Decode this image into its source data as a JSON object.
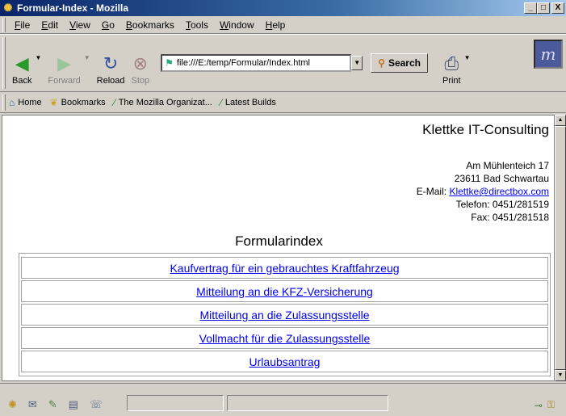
{
  "window": {
    "title": "Formular-Index - Mozilla",
    "min": "_",
    "max": "□",
    "close": "X"
  },
  "menu": [
    {
      "label": "File",
      "ul": "F",
      "rest": "ile"
    },
    {
      "label": "Edit",
      "ul": "E",
      "rest": "dit"
    },
    {
      "label": "View",
      "ul": "V",
      "rest": "iew"
    },
    {
      "label": "Go",
      "ul": "G",
      "rest": "o"
    },
    {
      "label": "Bookmarks",
      "ul": "B",
      "rest": "ookmarks"
    },
    {
      "label": "Tools",
      "ul": "T",
      "rest": "ools"
    },
    {
      "label": "Window",
      "ul": "W",
      "rest": "indow"
    },
    {
      "label": "Help",
      "ul": "H",
      "rest": "elp"
    }
  ],
  "nav": {
    "back": "Back",
    "forward": "Forward",
    "reload": "Reload",
    "stop": "Stop",
    "url": "file:///E:/temp/Formular/Index.html",
    "search": "Search",
    "print": "Print"
  },
  "personal": {
    "home": "Home",
    "bookmarks": "Bookmarks",
    "mozilla_org": "The Mozilla Organizat...",
    "latest_builds": "Latest Builds"
  },
  "page": {
    "company": "Klettke IT-Consulting",
    "street": "Am Mühlenteich 17",
    "city": "23611 Bad Schwartau",
    "email_label": "E-Mail: ",
    "email": "Klettke@directbox.com",
    "phone": "Telefon: 0451/281519",
    "fax": "Fax: 0451/281518",
    "heading": "Formularindex",
    "forms": [
      "Kaufvertrag für ein gebrauchtes Kraftfahrzeug",
      "Mitteilung an die KFZ-Versicherung",
      "Mitteilung an die Zulassungsstelle",
      "Vollmacht für die Zulassungsstelle",
      "Urlaubsantrag"
    ]
  },
  "icons": {
    "back": "green-arrow-left",
    "forward": "green-arrow-right",
    "reload": "reload",
    "stop": "stop",
    "search": "magnifier",
    "print": "printer",
    "home": "house",
    "bookmarks": "bookmark",
    "link": "mozilla-link"
  }
}
